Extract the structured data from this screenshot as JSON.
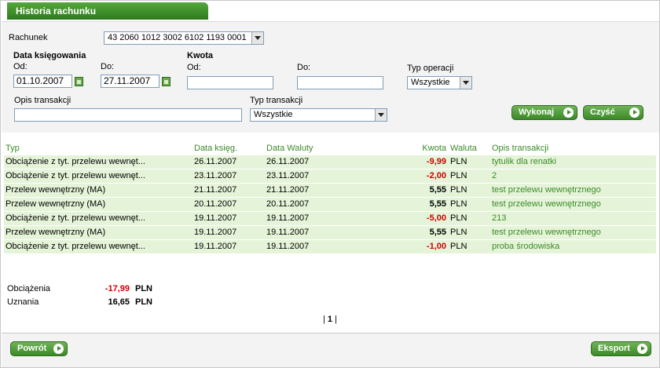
{
  "header": {
    "title": "Historia rachunku"
  },
  "filters": {
    "account_label": "Rachunek",
    "account_value": "43 2060 1012 3002 6102 1193 0001",
    "booking_date_label": "Data księgowania",
    "from_label": "Od:",
    "to_label": "Do:",
    "date_from": "01.10.2007",
    "date_to": "27.11.2007",
    "amount_label": "Kwota",
    "amount_from_label": "Od:",
    "amount_to_label": "Do:",
    "amount_from": "",
    "amount_to": "",
    "operation_type_label": "Typ operacji",
    "operation_type_value": "Wszystkie",
    "description_label": "Opis transakcji",
    "description_value": "",
    "transaction_type_label": "Typ transakcji",
    "transaction_type_value": "Wszystkie",
    "execute_label": "Wykonaj",
    "clear_label": "Czyść"
  },
  "table": {
    "columns": [
      "Typ",
      "Data księg.",
      "Data Waluty",
      "Kwota",
      "Waluta",
      "Opis transakcji"
    ],
    "rows": [
      {
        "type": "Obciążenie z tyt. przelewu wewnęt...",
        "booking": "26.11.2007",
        "value_date": "26.11.2007",
        "amount": "-9,99",
        "currency": "PLN",
        "description": "tytulik dla renatki"
      },
      {
        "type": "Obciążenie z tyt. przelewu wewnęt...",
        "booking": "23.11.2007",
        "value_date": "23.11.2007",
        "amount": "-2,00",
        "currency": "PLN",
        "description": "2"
      },
      {
        "type": "Przelew wewnętrzny (MA)",
        "booking": "21.11.2007",
        "value_date": "21.11.2007",
        "amount": "5,55",
        "currency": "PLN",
        "description": "test przelewu wewnętrznego"
      },
      {
        "type": "Przelew wewnętrzny (MA)",
        "booking": "20.11.2007",
        "value_date": "20.11.2007",
        "amount": "5,55",
        "currency": "PLN",
        "description": "test przelewu wewnętrznego"
      },
      {
        "type": "Obciążenie z tyt. przelewu wewnęt...",
        "booking": "19.11.2007",
        "value_date": "19.11.2007",
        "amount": "-5,00",
        "currency": "PLN",
        "description": "213"
      },
      {
        "type": "Przelew wewnętrzny (MA)",
        "booking": "19.11.2007",
        "value_date": "19.11.2007",
        "amount": "5,55",
        "currency": "PLN",
        "description": "test przelewu wewnętrznego"
      },
      {
        "type": "Obciążenie z tyt. przelewu wewnęt...",
        "booking": "19.11.2007",
        "value_date": "19.11.2007",
        "amount": "-1,00",
        "currency": "PLN",
        "description": "proba środowiska"
      }
    ]
  },
  "summary": {
    "debits_label": "Obciążenia",
    "debits_value": "-17,99",
    "debits_currency": "PLN",
    "credits_label": "Uznania",
    "credits_value": "16,65",
    "credits_currency": "PLN"
  },
  "pager": {
    "prefix": "|",
    "current": "1",
    "suffix": "|"
  },
  "footer": {
    "back_label": "Powrót",
    "export_label": "Eksport"
  },
  "colors": {
    "brand_green": "#3b8a27",
    "row_bg": "#e5f4d9",
    "negative": "#cc0000"
  }
}
